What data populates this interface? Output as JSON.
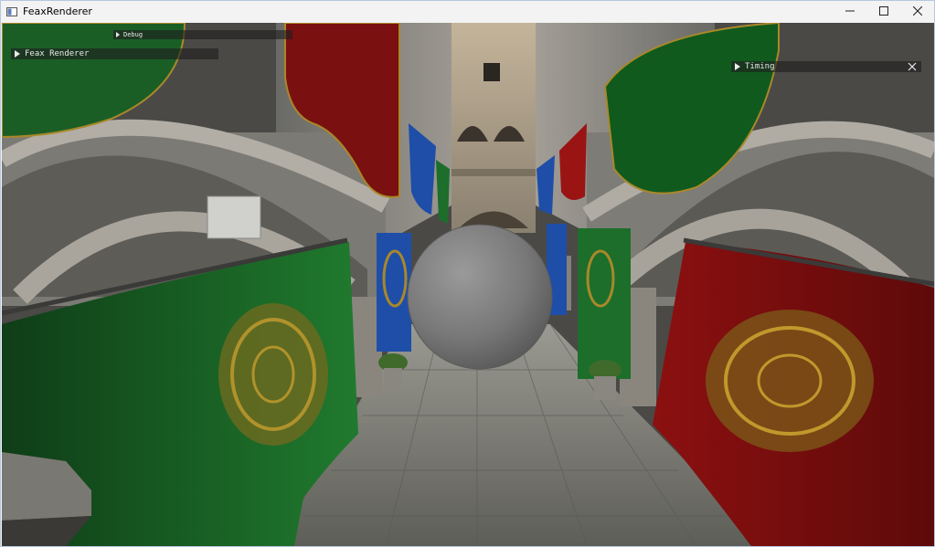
{
  "window": {
    "title": "FeaxRenderer",
    "app_icon": "window-icon",
    "controls": {
      "minimize_icon": "minimize-icon",
      "maximize_icon": "maximize-icon",
      "close_icon": "close-icon"
    }
  },
  "overlay": {
    "debug_panel": {
      "label": "Debug",
      "icon": "collapse-arrow-icon"
    },
    "feax_panel": {
      "label": "Feax Renderer",
      "icon": "collapse-arrow-icon"
    },
    "timing_panel": {
      "label": "Timing",
      "icon": "collapse-arrow-icon",
      "close_icon": "close-icon"
    }
  },
  "scene": {
    "description_colors": {
      "green_drape": "#1c6e2a",
      "red_drape": "#9a1414",
      "blue_drape": "#1f4ea8",
      "stone": "#8e8a82",
      "sphere": "#7a7a7a",
      "gold": "#a8882a"
    }
  }
}
